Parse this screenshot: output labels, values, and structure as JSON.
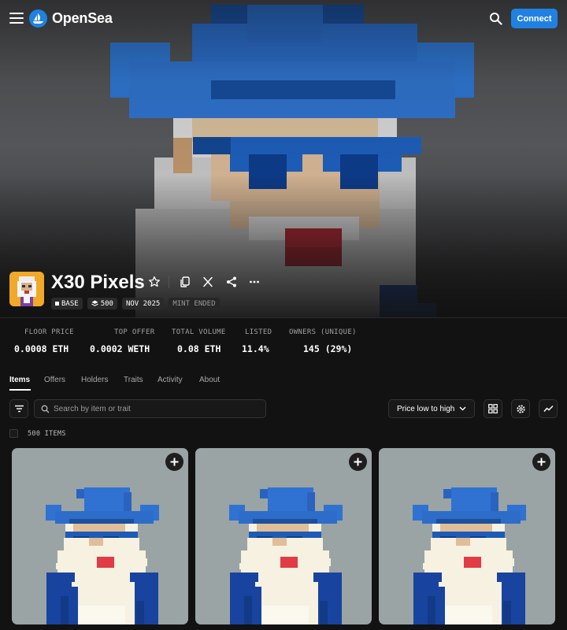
{
  "brand": {
    "name": "OpenSea",
    "color": "#2081e2"
  },
  "nav": {
    "connect_label": "Connect",
    "menu_icon": "menu-icon",
    "search_icon": "search-icon"
  },
  "collection": {
    "title": "X30 Pixels",
    "badges": {
      "chain": "BASE",
      "supply": "500",
      "date": "NOV 2025",
      "status": "MINT ENDED"
    }
  },
  "stats": [
    {
      "label": "FLOOR PRICE",
      "value": "0.0008 ETH"
    },
    {
      "label": "TOP OFFER",
      "value": "0.0002 WETH"
    },
    {
      "label": "TOTAL VOLUME",
      "value": "0.08 ETH"
    },
    {
      "label": "LISTED",
      "value": "11.4%"
    },
    {
      "label": "OWNERS (UNIQUE)",
      "value": "145 (29%)"
    }
  ],
  "tabs": [
    {
      "label": "Items",
      "active": true
    },
    {
      "label": "Offers"
    },
    {
      "label": "Holders"
    },
    {
      "label": "Traits"
    },
    {
      "label": "Activity"
    },
    {
      "label": "About"
    }
  ],
  "toolbar": {
    "search_placeholder": "Search by item or trait",
    "sort_label": "Price low to high"
  },
  "items_count_label": "500 ITEMS",
  "colors": {
    "background": "#121212",
    "card_background": "#9aa4a4",
    "hat_blue": "#2a6fd0",
    "robe_blue": "#1844a0",
    "beard": "#f6f1e0"
  }
}
